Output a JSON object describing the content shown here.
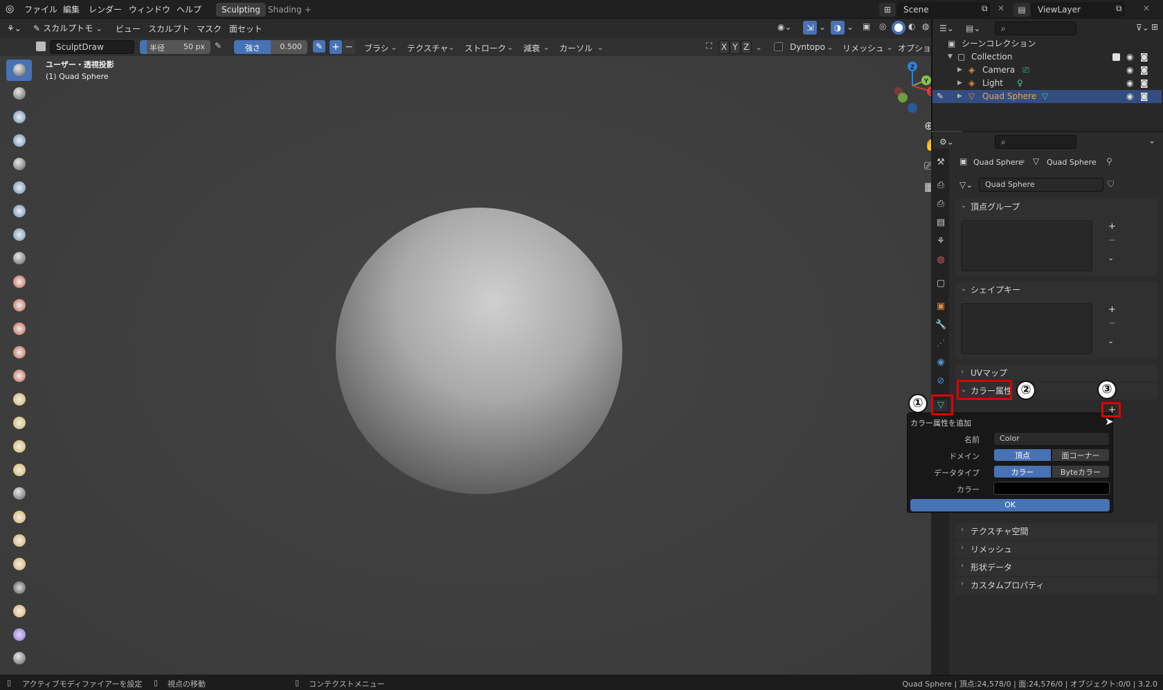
{
  "topbar": {
    "menus": [
      "ファイル",
      "編集",
      "レンダー",
      "ウィンドウ",
      "ヘルプ"
    ],
    "workspace_tabs": [
      "Sculpting",
      "Shading"
    ],
    "active_tab": "Sculpting",
    "add_tab": "+",
    "scene": "Scene",
    "view_layer": "ViewLayer"
  },
  "viewport_header": {
    "mode": "スカルプトモード",
    "mode_short": "スカルプトモ",
    "menus": [
      "ビュー",
      "スカルプト",
      "マスク",
      "面セット"
    ]
  },
  "tool_header": {
    "brush_name": "SculptDraw",
    "radius_label": "半径",
    "radius_value": "50 px",
    "strength_label": "強さ",
    "strength_value": "0.500",
    "plus": "+",
    "minus": "−",
    "dropdowns": [
      "ブラシ",
      "テクスチャ",
      "ストローク",
      "減衰",
      "カーソル"
    ],
    "axes": [
      "X",
      "Y",
      "Z"
    ],
    "dyntopo": "Dyntopo",
    "remesh": "リメッシュ",
    "options": "オプション"
  },
  "viewport": {
    "view_name": "ユーザー・透視投影",
    "object_name": "(1) Quad Sphere",
    "gizmo_axes": [
      "Z",
      "Y",
      "X"
    ]
  },
  "outliner": {
    "title": "シーンコレクション",
    "items": [
      {
        "name": "Collection"
      },
      {
        "name": "Camera"
      },
      {
        "name": "Light"
      },
      {
        "name": "Quad Sphere",
        "selected": true
      }
    ]
  },
  "properties": {
    "breadcrumb_object": "Quad Sphere",
    "breadcrumb_data": "Quad Sphere",
    "mesh_name": "Quad Sphere",
    "panels": {
      "vertex_groups": "頂点グループ",
      "shape_keys": "シェイプキー",
      "uv_maps": "UVマップ",
      "color_attributes": "カラー属性",
      "texture_space": "テクスチャ空間",
      "remesh": "リメッシュ",
      "geometry_data": "形状データ",
      "custom_props": "カスタムプロパティ"
    }
  },
  "annotations": {
    "one": "①",
    "two": "②",
    "three": "③"
  },
  "popup": {
    "title": "カラー属性を追加",
    "name_label": "名前",
    "name_value": "Color",
    "domain_label": "ドメイン",
    "domain_options": [
      "頂点",
      "面コーナー"
    ],
    "domain_selected": "頂点",
    "datatype_label": "データタイプ",
    "datatype_options": [
      "カラー",
      "Byteカラー"
    ],
    "datatype_selected": "カラー",
    "color_label": "カラー",
    "color_value": "#000000",
    "ok": "OK"
  },
  "statusbar": {
    "left1": "アクティブモディファイアーを設定",
    "left2": "視点の移動",
    "left3": "コンテクストメニュー",
    "right": "Quad Sphere | 頂点:24,578/0 | 面:24,576/0 | オブジェクト:0/0 | 3.2.0"
  },
  "colors": {
    "accent": "#4772b3",
    "highlight": "#e00000",
    "selected_row": "#334d80"
  }
}
